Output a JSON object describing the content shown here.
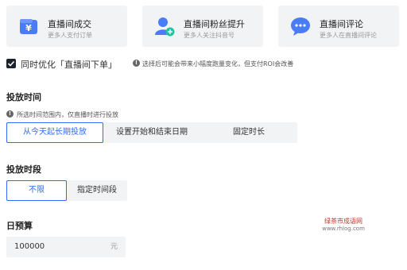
{
  "goals": [
    {
      "title": "直播间成交",
      "subtitle": "更多人支付订单",
      "icon": "wallet-yen-icon"
    },
    {
      "title": "直播间粉丝提升",
      "subtitle": "更多人关注抖音号",
      "icon": "user-add-icon"
    },
    {
      "title": "直播间评论",
      "subtitle": "更多人在直播间评论",
      "icon": "chat-bubble-icon"
    }
  ],
  "optimize": {
    "checked": true,
    "label": "同时优化「直播间下单」",
    "hint": "选择后可能会带来小幅度跑量变化，但支付ROI会改善"
  },
  "schedule": {
    "title": "投放时间",
    "hint": "所选时间范围内，仅直播时进行投放",
    "options": [
      "从今天起长期投放",
      "设置开始和结束日期",
      "固定时长"
    ],
    "selected": "从今天起长期投放"
  },
  "period": {
    "title": "投放时段",
    "options": [
      "不限",
      "指定时间段"
    ],
    "selected": "不限"
  },
  "budget": {
    "title": "日预算",
    "value": "100000",
    "unit": "元"
  },
  "watermark": {
    "line1": "绿茶市成语网",
    "line2": "www.rhlog.com"
  },
  "colors": {
    "accent": "#2f6bff",
    "goal_icon_blue": "#4a7cf7",
    "card_bg": "#f2f3f5"
  }
}
